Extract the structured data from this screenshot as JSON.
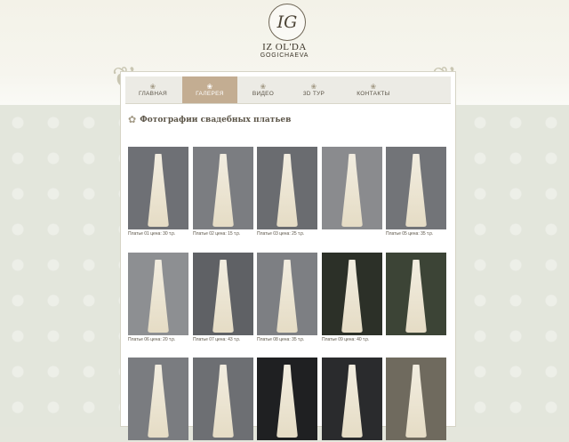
{
  "brand": {
    "monogram": "IG",
    "name": "IZ OL'DA",
    "subtitle": "GOGICHAEVA"
  },
  "nav": {
    "items": [
      {
        "label": "ГЛАВНАЯ",
        "icon": "flower-icon",
        "active": false
      },
      {
        "label": "ГАЛЕРЕЯ",
        "icon": "flower-icon",
        "active": true
      },
      {
        "label": "ВИДЕО",
        "icon": "flower-icon",
        "active": false
      },
      {
        "label": "3D ТУР",
        "icon": "flower-icon",
        "active": false
      },
      {
        "label": "КОНТАКТЫ",
        "icon": "flower-icon",
        "active": false
      }
    ]
  },
  "section": {
    "icon": "rose-icon",
    "title": "Фотографии свадебных платьев"
  },
  "gallery": {
    "items": [
      {
        "caption": "Платье 01 цена: 30 т.р.",
        "background": "#6e7075"
      },
      {
        "caption": "Платье 02 цена: 15 т.р.",
        "background": "#7b7d81"
      },
      {
        "caption": "Платье 03 цена: 25 т.р.",
        "background": "#6a6c70"
      },
      {
        "caption": "",
        "background": "#8a8b8e"
      },
      {
        "caption": "Платье 05 цена: 35 т.р.",
        "background": "#727478"
      },
      {
        "caption": "Платье 06 цена: 20 т.р.",
        "background": "#8d8f92"
      },
      {
        "caption": "Платье 07 цена: 43 т.р.",
        "background": "#5f6165"
      },
      {
        "caption": "Платье 08 цена: 35 т.р.",
        "background": "#7d7f83"
      },
      {
        "caption": "Платье 09 цена: 40 т.р.",
        "background": "#2c3028"
      },
      {
        "caption": "",
        "background": "#3c4436"
      },
      {
        "caption": "",
        "background": "#7a7c80"
      },
      {
        "caption": "",
        "background": "#6d6f73"
      },
      {
        "caption": "",
        "background": "#1f2022"
      },
      {
        "caption": "",
        "background": "#2a2b2d"
      },
      {
        "caption": "",
        "background": "#6f6a5e"
      }
    ]
  }
}
